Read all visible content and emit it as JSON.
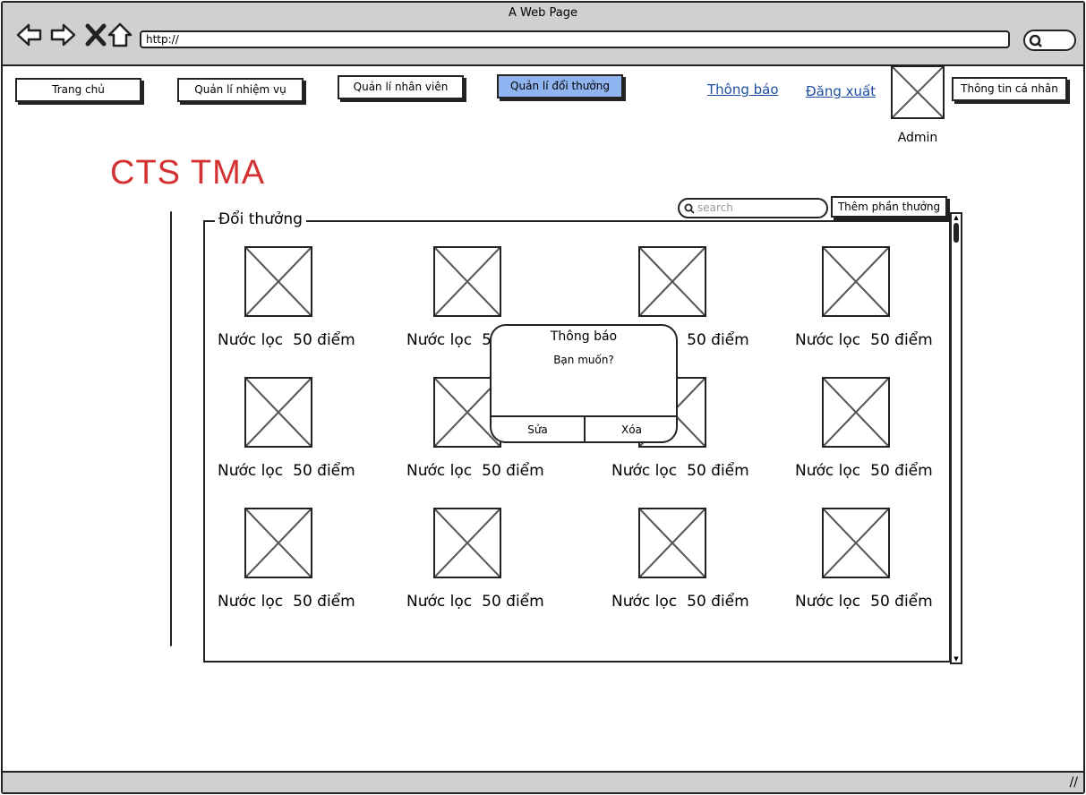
{
  "window": {
    "title": "A Web Page",
    "url": "http://"
  },
  "nav": {
    "home": "Trang chủ",
    "tasks": "Quản lí nhiệm vụ",
    "staff": "Quản lí nhân viên",
    "rewards": "Quản lí đổi thưởng",
    "notifications": "Thông báo",
    "logout": "Đăng xuất",
    "profile": "Thông tin cá nhân",
    "user": "Admin"
  },
  "brand": "CTS TMA",
  "toolbar": {
    "search_placeholder": "search",
    "add_label": "Thêm phần thưởng"
  },
  "panel": {
    "title": "Đổi thưởng",
    "items": [
      {
        "name": "Nước lọc",
        "points": "50 điểm"
      },
      {
        "name": "Nước lọc",
        "points": "50 điểm"
      },
      {
        "name": "Nước lọc",
        "points": "50 điểm"
      },
      {
        "name": "Nước lọc",
        "points": "50 điểm"
      },
      {
        "name": "Nước lọc",
        "points": "50 điểm"
      },
      {
        "name": "Nước lọc",
        "points": "50 điểm"
      },
      {
        "name": "Nước lọc",
        "points": "50 điểm"
      },
      {
        "name": "Nước lọc",
        "points": "50 điểm"
      },
      {
        "name": "Nước lọc",
        "points": "50 điểm"
      },
      {
        "name": "Nước lọc",
        "points": "50 điểm"
      },
      {
        "name": "Nước lọc",
        "points": "50 điểm"
      },
      {
        "name": "Nước lọc",
        "points": "50 điểm"
      }
    ]
  },
  "dialog": {
    "title": "Thông báo",
    "message": "Bạn muốn?",
    "edit": "Sửa",
    "delete": "Xóa"
  },
  "colors": {
    "brand": "#d43232",
    "active_nav": "#8fb4f0",
    "link": "#1d4fa3"
  },
  "icons": [
    "back-arrow-icon",
    "forward-arrow-icon",
    "close-icon",
    "home-icon",
    "search-icon",
    "image-placeholder-icon",
    "resize-grip-icon"
  ]
}
